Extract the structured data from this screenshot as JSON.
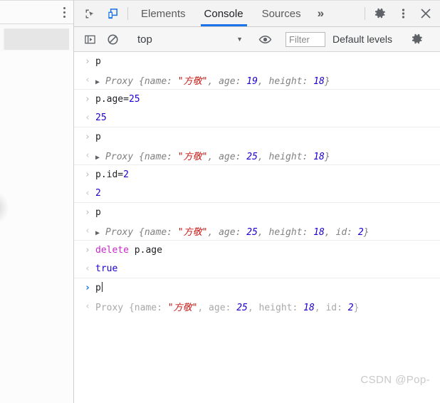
{
  "window": {
    "title": "Chrome DevTools Console"
  },
  "page_pane": {
    "kebab_icon": "vertical-ellipsis-icon",
    "omnibar_value": ""
  },
  "toolbar": {
    "inspect_icon": "inspect-element-icon",
    "device_icon": "device-toolbar-icon",
    "tabs": [
      {
        "label": "Elements",
        "active": false
      },
      {
        "label": "Console",
        "active": true
      },
      {
        "label": "Sources",
        "active": false
      }
    ],
    "more_tabs_label": "»",
    "settings_icon": "gear-icon",
    "menu_icon": "vertical-ellipsis-icon",
    "close_icon": "close-icon"
  },
  "filterbar": {
    "sidebar_toggle_icon": "console-sidebar-icon",
    "clear_icon": "clear-console-icon",
    "context": "top",
    "context_caret": "▼",
    "eye_icon": "live-expression-eye-icon",
    "filter_placeholder": "Filter",
    "filter_value": "",
    "levels_label": "Default levels",
    "settings_icon": "gear-icon"
  },
  "console": {
    "prompt_in": "›",
    "prompt_out": "‹",
    "disclosure": "▶",
    "groups": [
      {
        "input": "p",
        "output_parts": [
          {
            "t": "Proxy {name: ",
            "c": "obj"
          },
          {
            "t": "\"方敬\"",
            "c": "str"
          },
          {
            "t": ", age: ",
            "c": "obj"
          },
          {
            "t": "19",
            "c": "num"
          },
          {
            "t": ", height: ",
            "c": "obj"
          },
          {
            "t": "18",
            "c": "num"
          },
          {
            "t": "}",
            "c": "obj"
          }
        ],
        "expandable": true
      },
      {
        "input_parts": [
          {
            "t": "p.age=",
            "c": "plain"
          },
          {
            "t": "25",
            "c": "numplain"
          }
        ],
        "output_parts": [
          {
            "t": "25",
            "c": "bool"
          }
        ],
        "expandable": false
      },
      {
        "input": "p",
        "output_parts": [
          {
            "t": "Proxy {name: ",
            "c": "obj"
          },
          {
            "t": "\"方敬\"",
            "c": "str"
          },
          {
            "t": ", age: ",
            "c": "obj"
          },
          {
            "t": "25",
            "c": "num"
          },
          {
            "t": ", height: ",
            "c": "obj"
          },
          {
            "t": "18",
            "c": "num"
          },
          {
            "t": "}",
            "c": "obj"
          }
        ],
        "expandable": true
      },
      {
        "input_parts": [
          {
            "t": "p.id=",
            "c": "plain"
          },
          {
            "t": "2",
            "c": "numplain"
          }
        ],
        "output_parts": [
          {
            "t": "2",
            "c": "bool"
          }
        ],
        "expandable": false
      },
      {
        "input": "p",
        "output_parts": [
          {
            "t": "Proxy {name: ",
            "c": "obj"
          },
          {
            "t": "\"方敬\"",
            "c": "str"
          },
          {
            "t": ", age: ",
            "c": "obj"
          },
          {
            "t": "25",
            "c": "num"
          },
          {
            "t": ", height: ",
            "c": "obj"
          },
          {
            "t": "18",
            "c": "num"
          },
          {
            "t": ", id: ",
            "c": "obj"
          },
          {
            "t": "2",
            "c": "num"
          },
          {
            "t": "}",
            "c": "obj"
          }
        ],
        "expandable": true
      },
      {
        "input_parts": [
          {
            "t": "delete",
            "c": "kw"
          },
          {
            "t": " p.age",
            "c": "plain"
          }
        ],
        "output_parts": [
          {
            "t": "true",
            "c": "bool"
          }
        ],
        "expandable": false
      }
    ],
    "active_prompt": {
      "value": "p",
      "preview_parts": [
        {
          "t": "Proxy {name: ",
          "c": "g"
        },
        {
          "t": "\"方敬\"",
          "c": "str"
        },
        {
          "t": ", age: ",
          "c": "g"
        },
        {
          "t": "25",
          "c": "num"
        },
        {
          "t": ", height: ",
          "c": "g"
        },
        {
          "t": "18",
          "c": "num"
        },
        {
          "t": ", id: ",
          "c": "g"
        },
        {
          "t": "2",
          "c": "num"
        },
        {
          "t": "}",
          "c": "g"
        }
      ]
    }
  },
  "watermark": {
    "text": "CSDN @Pop-"
  },
  "colors": {
    "accent": "#1a73e8",
    "string": "#c41a16",
    "number": "#1c00cf",
    "keyword": "#c929c9",
    "object": "#808080",
    "separator": "#ededed"
  }
}
